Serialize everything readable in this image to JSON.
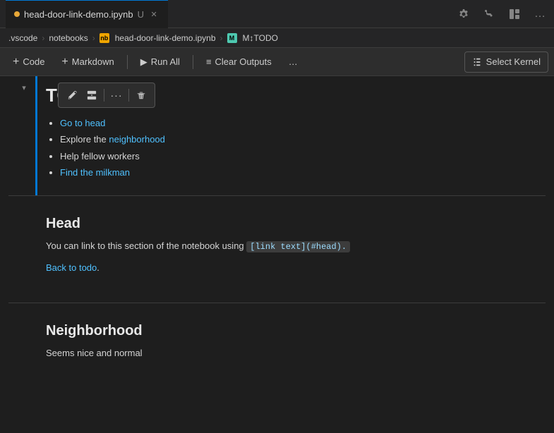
{
  "titlebar": {
    "tab_name": "head-door-link-demo.ipynb",
    "tab_modified": "U",
    "settings_icon": "⚙",
    "branch_icon": "⑂",
    "layout_icon": "▣",
    "more_icon": "…"
  },
  "breadcrumb": {
    "vscode": ".vscode",
    "sep1": ">",
    "notebooks": "notebooks",
    "sep2": ">",
    "filename": "head-door-link-demo.ipynb",
    "sep3": ">",
    "section": "M↕TODO"
  },
  "toolbar": {
    "code_label": "Code",
    "markdown_label": "Markdown",
    "run_all_label": "Run All",
    "clear_outputs_label": "Clear Outputs",
    "more_label": "…",
    "select_kernel_label": "Select Kernel"
  },
  "cell_toolbar": {
    "edit_icon": "✎",
    "split_icon": "⊟",
    "more_icon": "…",
    "delete_icon": "🗑"
  },
  "notebook": {
    "todo_heading": "TODO",
    "todo_items": [
      {
        "text": "Go to head",
        "link": true
      },
      {
        "text_before": "Explore the ",
        "text_linked": "neighborhood",
        "link": true
      },
      {
        "text": "Help fellow workers",
        "link": false
      },
      {
        "text": "Find the milkman",
        "link": true
      }
    ],
    "head_heading": "Head",
    "head_paragraph_before": "You can link to this section of the notebook using ",
    "head_code": "[link text](#head).",
    "head_paragraph_after": "",
    "back_link_text": "Back to todo",
    "back_link_suffix": ".",
    "neighborhood_heading": "Neighborhood",
    "neighborhood_paragraph": "Seems nice and normal"
  }
}
